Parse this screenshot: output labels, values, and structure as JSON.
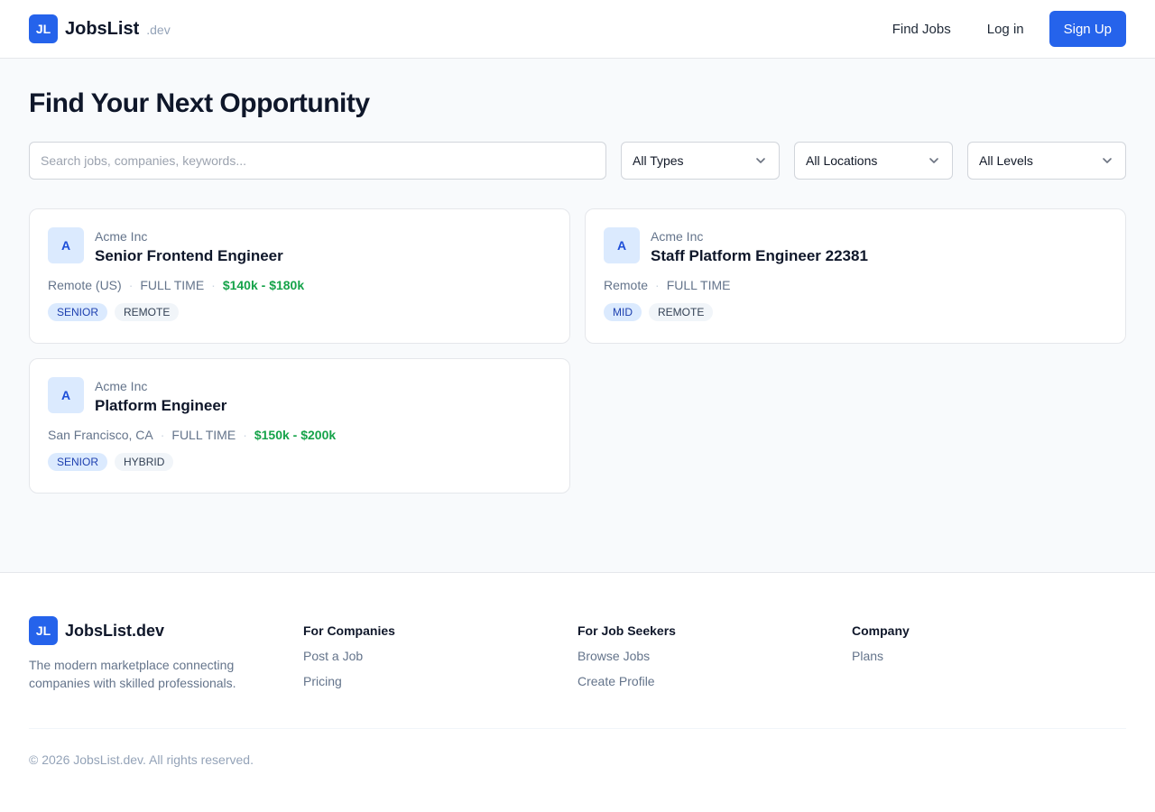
{
  "header": {
    "logo_text": "JL",
    "brand": "JobsList",
    "brand_suffix": ".dev",
    "nav": {
      "find_jobs": "Find Jobs",
      "login": "Log in",
      "signup": "Sign Up"
    }
  },
  "main": {
    "title": "Find Your Next Opportunity",
    "search_placeholder": "Search jobs, companies, keywords...",
    "filters": {
      "type": "All Types",
      "location": "All Locations",
      "level": "All Levels"
    },
    "jobs": [
      {
        "avatar": "A",
        "company": "Acme Inc",
        "title": "Senior Frontend Engineer",
        "location": "Remote (US)",
        "employment": "FULL TIME",
        "salary": "$140k - $180k",
        "level": "SENIOR",
        "mode": "REMOTE"
      },
      {
        "avatar": "A",
        "company": "Acme Inc",
        "title": "Staff Platform Engineer 22381",
        "location": "Remote",
        "employment": "FULL TIME",
        "salary": "",
        "level": "MID",
        "mode": "REMOTE"
      },
      {
        "avatar": "A",
        "company": "Acme Inc",
        "title": "Platform Engineer",
        "location": "San Francisco, CA",
        "employment": "FULL TIME",
        "salary": "$150k - $200k",
        "level": "SENIOR",
        "mode": "HYBRID"
      }
    ]
  },
  "footer": {
    "logo_text": "JL",
    "brand": "JobsList.dev",
    "tagline": "The modern marketplace connecting companies with skilled professionals.",
    "columns": [
      {
        "heading": "For Companies",
        "links": [
          "Post a Job",
          "Pricing"
        ]
      },
      {
        "heading": "For Job Seekers",
        "links": [
          "Browse Jobs",
          "Create Profile"
        ]
      },
      {
        "heading": "Company",
        "links": [
          "Plans"
        ]
      }
    ],
    "copyright": "© 2026 JobsList.dev. All rights reserved."
  },
  "colors": {
    "accent": "#2563eb",
    "salary": "#16a34a",
    "level_tag_bg": "#dbeafe"
  },
  "icons": {
    "select_arrow": "chevron-down-icon"
  }
}
